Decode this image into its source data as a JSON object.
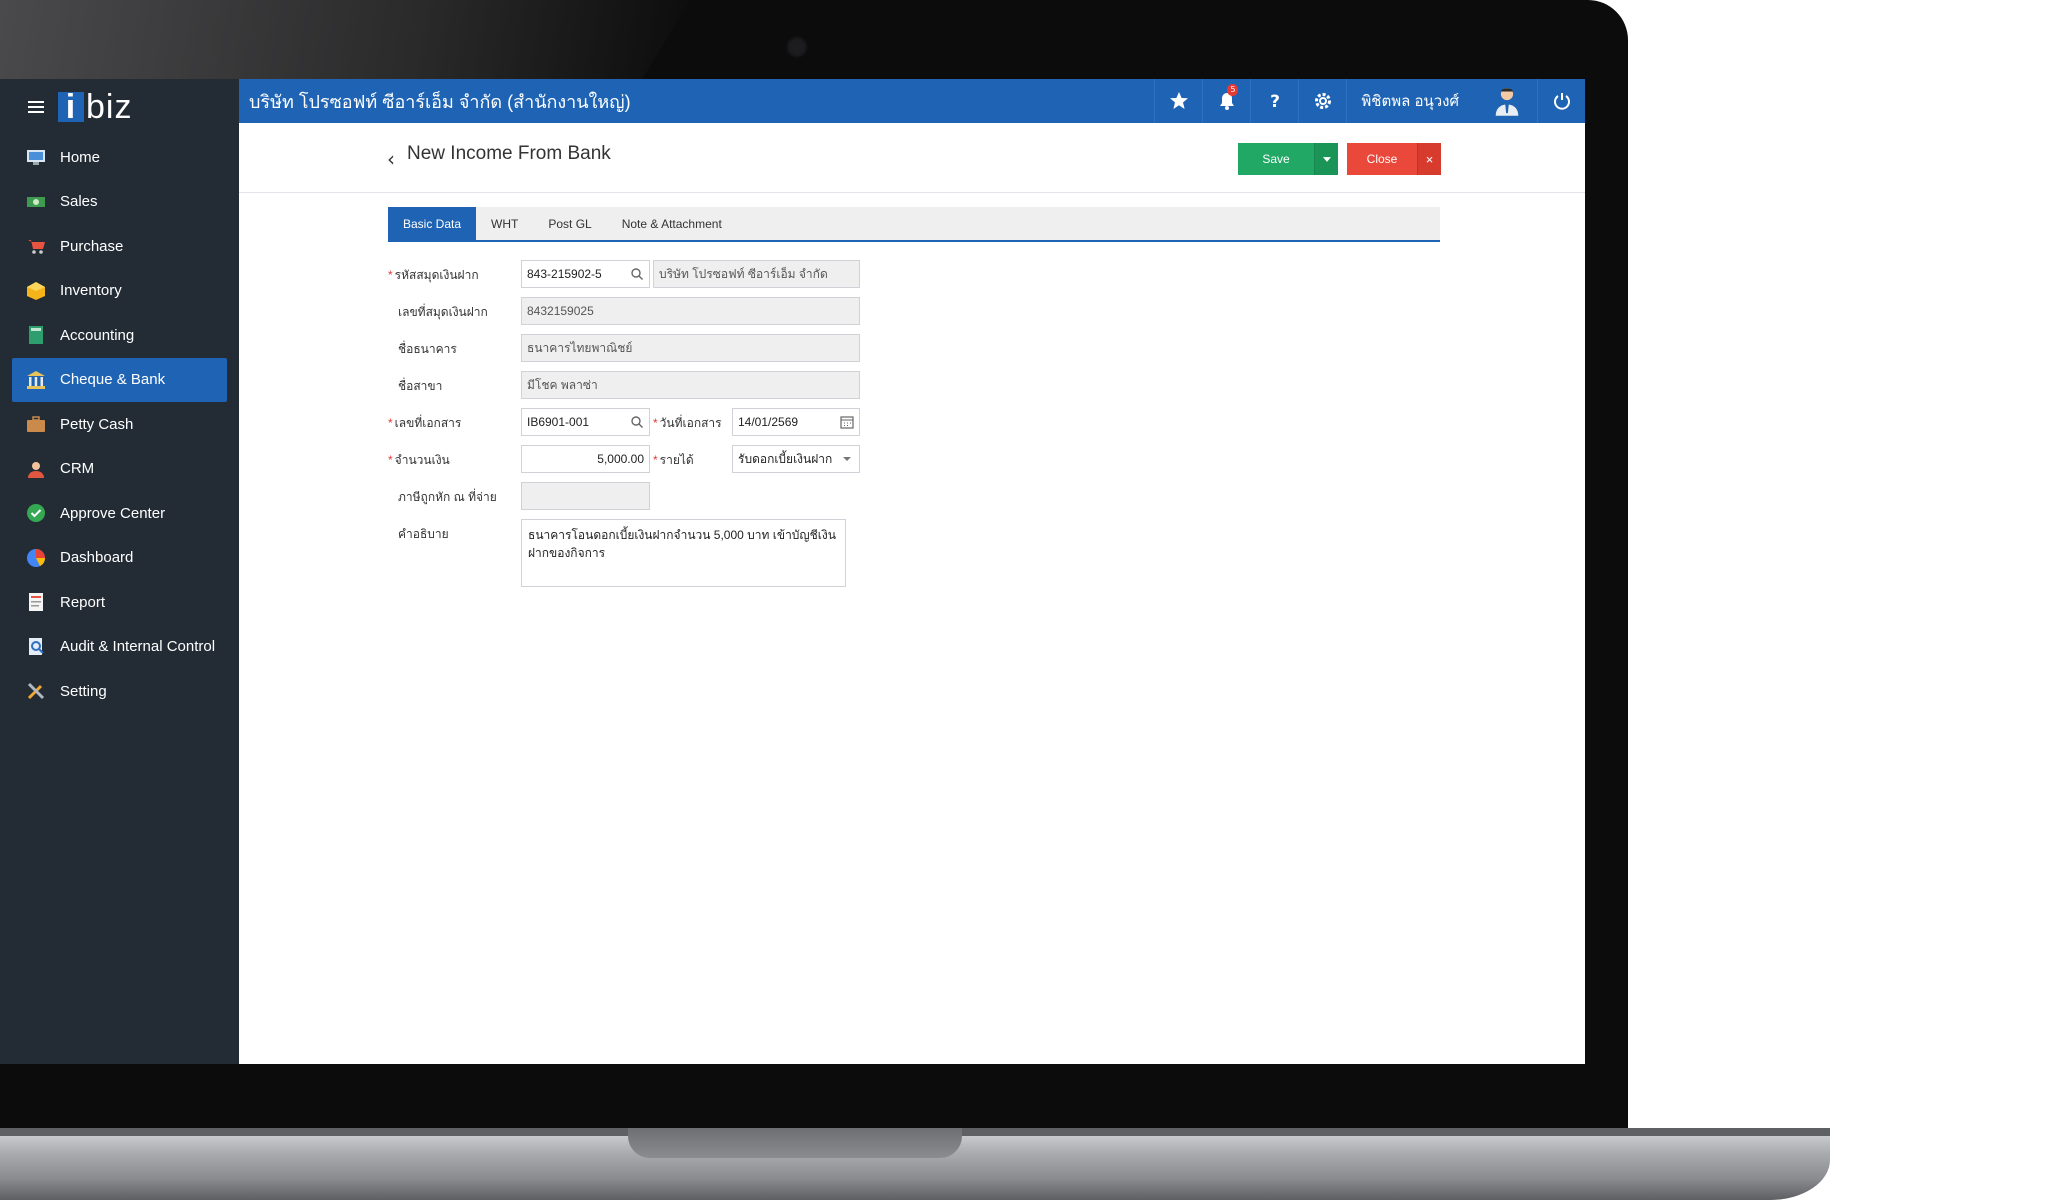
{
  "app": {
    "logo_text": "biz",
    "logo_mark": "i"
  },
  "topbar": {
    "company": "บริษัท โปรซอฟท์ ซีอาร์เอ็ม จำกัด (สำนักงานใหญ่)",
    "notification_count": "5",
    "user_name": "พิชิตพล อนุวงศ์",
    "accent": "#1f64b4"
  },
  "sidebar": {
    "items": [
      {
        "label": "Home",
        "icon": "home-icon"
      },
      {
        "label": "Sales",
        "icon": "sales-icon"
      },
      {
        "label": "Purchase",
        "icon": "cart-icon"
      },
      {
        "label": "Inventory",
        "icon": "box-icon"
      },
      {
        "label": "Accounting",
        "icon": "ledger-icon"
      },
      {
        "label": "Cheque & Bank",
        "icon": "bank-icon"
      },
      {
        "label": "Petty Cash",
        "icon": "briefcase-icon"
      },
      {
        "label": "CRM",
        "icon": "crm-icon"
      },
      {
        "label": "Approve Center",
        "icon": "check-circle-icon"
      },
      {
        "label": "Dashboard",
        "icon": "pie-chart-icon"
      },
      {
        "label": "Report",
        "icon": "report-icon"
      },
      {
        "label": "Audit & Internal Control",
        "icon": "audit-icon"
      },
      {
        "label": "Setting",
        "icon": "tools-icon"
      }
    ],
    "active_index": 5
  },
  "page": {
    "back_symbol": "‹",
    "title": "New Income From Bank",
    "save_label": "Save",
    "close_label": "Close",
    "close_x": "×"
  },
  "tabs": [
    "Basic Data",
    "WHT",
    "Post GL",
    "Note & Attachment"
  ],
  "form": {
    "account_code_label": "รหัสสมุดเงินฝาก",
    "account_code_value": "843-215902-5",
    "account_name_value": "บริษัท โปรซอฟท์ ซีอาร์เอ็ม จำกัด",
    "account_no_label": "เลขที่สมุดเงินฝาก",
    "account_no_value": "8432159025",
    "bank_name_label": "ชื่อธนาคาร",
    "bank_name_value": "ธนาคารไทยพาณิชย์",
    "branch_label": "ชื่อสาขา",
    "branch_value": "มีโชค พลาซ่า",
    "doc_no_label": "เลขที่เอกสาร",
    "doc_no_value": "IB6901-001",
    "doc_date_label": "วันที่เอกสาร",
    "doc_date_value": "14/01/2569",
    "amount_label": "จำนวนเงิน",
    "amount_value": "5,000.00",
    "income_type_label": "รายได้",
    "income_type_value": "รับดอกเบี้ยเงินฝาก",
    "wht_label": "ภาษีถูกหัก ณ ที่จ่าย",
    "wht_value": "",
    "description_label": "คำอธิบาย",
    "description_value": "ธนาคารโอนดอกเบี้ยเงินฝากจำนวน 5,000 บาท เข้าบัญชีเงินฝากของกิจการ"
  }
}
